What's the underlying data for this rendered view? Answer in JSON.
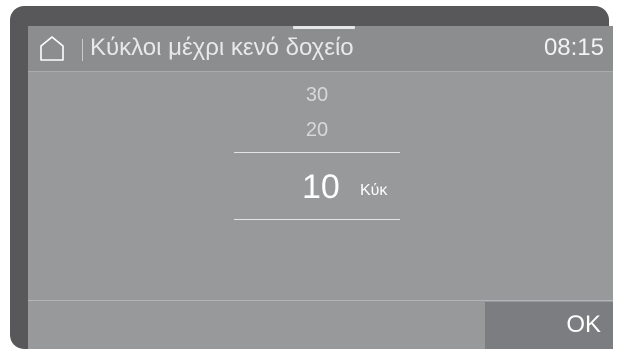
{
  "header": {
    "title": "Κύκλοι μέχρι κενό δοχείο",
    "time": "08:15",
    "home_icon": "home-icon"
  },
  "picker": {
    "options_above": [
      "30",
      "20"
    ],
    "selected_value": "10",
    "unit": "Κύκ"
  },
  "footer": {
    "ok_label": "OK"
  },
  "colors": {
    "frame": "#58585a",
    "screen": "#98999b",
    "ok_button": "#7c7d80",
    "text": "#ffffff"
  }
}
